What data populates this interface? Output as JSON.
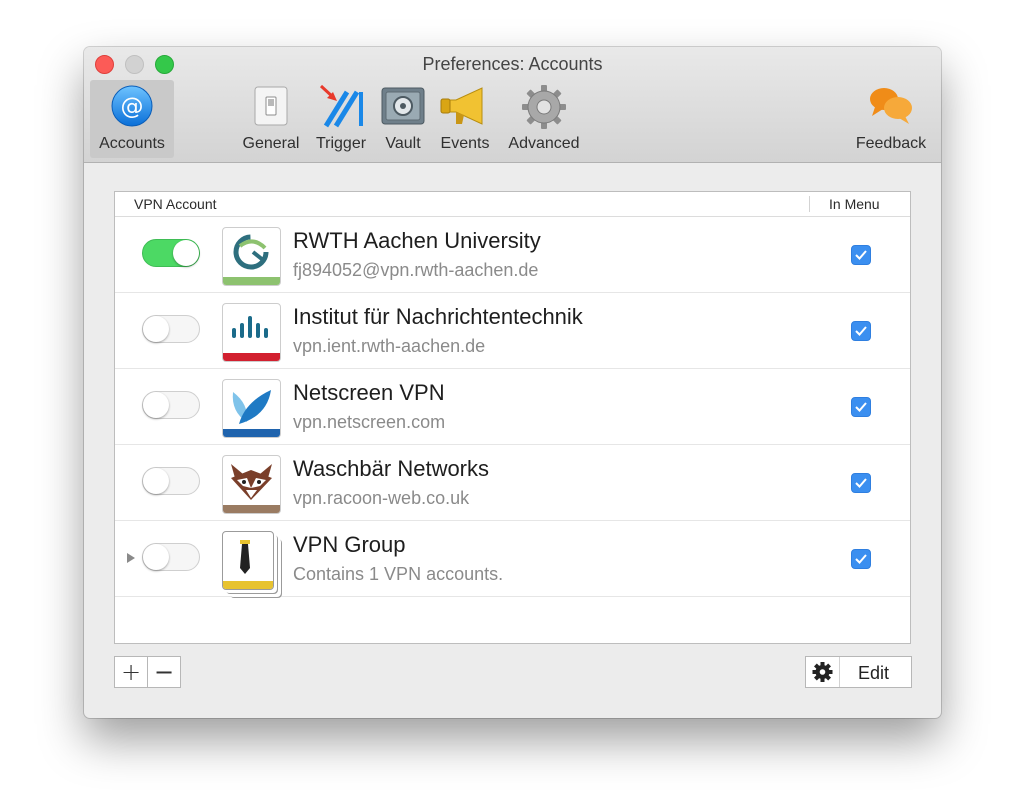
{
  "window": {
    "title": "Preferences: Accounts"
  },
  "toolbar": {
    "items": [
      {
        "id": "accounts",
        "label": "Accounts",
        "icon": "at-sign-icon",
        "selected": true
      },
      {
        "id": "general",
        "label": "General",
        "icon": "switch-icon"
      },
      {
        "id": "trigger",
        "label": "Trigger",
        "icon": "trigger-icon"
      },
      {
        "id": "vault",
        "label": "Vault",
        "icon": "safe-icon"
      },
      {
        "id": "events",
        "label": "Events",
        "icon": "megaphone-icon"
      },
      {
        "id": "advanced",
        "label": "Advanced",
        "icon": "gear-icon"
      },
      {
        "id": "feedback",
        "label": "Feedback",
        "icon": "speech-bubbles-icon"
      }
    ]
  },
  "table": {
    "header": {
      "name": "VPN Account",
      "menu": "In Menu"
    },
    "rows": [
      {
        "title": "RWTH Aachen University",
        "subtitle": "fj894052@vpn.rwth-aachen.de",
        "enabled": true,
        "in_menu": true,
        "icon": "rwth-logo-icon",
        "stripe_color": "#8dc26f"
      },
      {
        "title": "Institut für Nachrichtentechnik",
        "subtitle": "vpn.ient.rwth-aachen.de",
        "enabled": false,
        "in_menu": true,
        "icon": "cisco-logo-icon",
        "stripe_color": "#d2202f"
      },
      {
        "title": "Netscreen VPN",
        "subtitle": "vpn.netscreen.com",
        "enabled": false,
        "in_menu": true,
        "icon": "netscreen-logo-icon",
        "stripe_color": "#1f63ad"
      },
      {
        "title": "Waschbär Networks",
        "subtitle": "vpn.racoon-web.co.uk",
        "enabled": false,
        "in_menu": true,
        "icon": "raccoon-icon",
        "stripe_color": "#9a7b62"
      },
      {
        "title": "VPN Group",
        "subtitle": "Contains 1 VPN accounts.",
        "enabled": false,
        "in_menu": true,
        "icon": "vpn-group-icon",
        "stripe_color": "#e8c32f",
        "expandable": true
      }
    ]
  },
  "footer": {
    "add_label": "+",
    "remove_label": "−",
    "edit_label": "Edit"
  },
  "colors": {
    "toggle_on": "#4cd964",
    "checkbox": "#3b8ff0",
    "accent": "#1c8ef0"
  }
}
